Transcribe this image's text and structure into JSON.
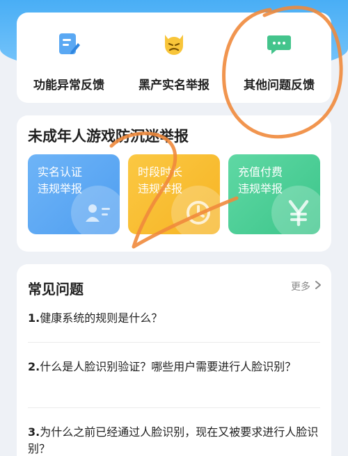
{
  "feedback": {
    "items": [
      {
        "label": "功能异常反馈",
        "icon": "edit-document-icon"
      },
      {
        "label": "黑产实名举报",
        "icon": "devil-face-icon"
      },
      {
        "label": "其他问题反馈",
        "icon": "chat-bubble-icon"
      }
    ]
  },
  "minor_report": {
    "title": "未成年人游戏防沉迷举报",
    "tiles": [
      {
        "line1": "实名认证",
        "line2": "违规举报",
        "icon": "id-card-icon"
      },
      {
        "line1": "时段时长",
        "line2": "违规举报",
        "icon": "clock-icon"
      },
      {
        "line1": "充值付费",
        "line2": "违规举报",
        "icon": "yen-icon"
      }
    ]
  },
  "faq": {
    "title": "常见问题",
    "more_label": "更多",
    "items": [
      {
        "num": "1.",
        "text": "健康系统的规则是什么？"
      },
      {
        "num": "2.",
        "text": "什么是人脸识别验证？哪些用户需要进行人脸识别？"
      },
      {
        "num": "3.",
        "text": "为什么之前已经通过人脸识别，现在又被要求进行人脸识别？"
      }
    ]
  },
  "colors": {
    "header_blue": "#49aef5",
    "tile_blue": "#5aa8f3",
    "tile_yellow": "#f8bd33",
    "tile_green": "#4ccf96",
    "scribble": "#f08a3c"
  }
}
